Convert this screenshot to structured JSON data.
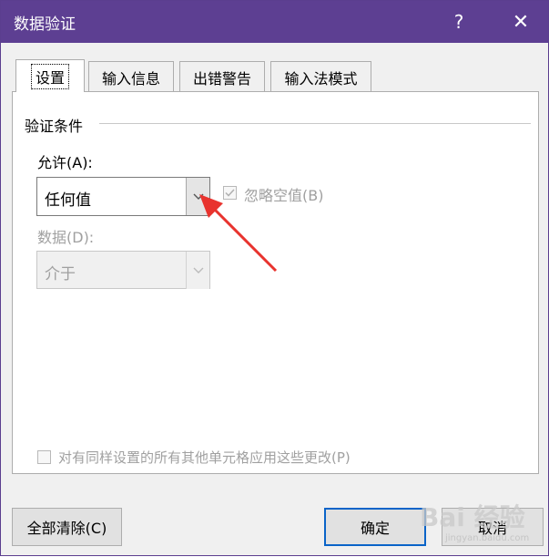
{
  "window": {
    "title": "数据验证",
    "help_glyph": "?",
    "close_glyph": "✕"
  },
  "tabs": [
    {
      "label": "设置",
      "active": true
    },
    {
      "label": "输入信息",
      "active": false
    },
    {
      "label": "出错警告",
      "active": false
    },
    {
      "label": "输入法模式",
      "active": false
    }
  ],
  "settings": {
    "group_label": "验证条件",
    "allow_label": "允许(A):",
    "allow_value": "任何值",
    "ignore_blank_label": "忽略空值(B)",
    "ignore_blank_checked": true,
    "data_label": "数据(D):",
    "data_value": "介于",
    "apply_all_label": "对有同样设置的所有其他单元格应用这些更改(P)",
    "apply_all_checked": false
  },
  "buttons": {
    "clear_all": "全部清除(C)",
    "ok": "确定",
    "cancel": "取消"
  },
  "watermark": {
    "text": "Bai 经验",
    "sub": "jingyan.baidu.com"
  },
  "colors": {
    "titlebar": "#5d3f92",
    "annotation_arrow": "#e8332e",
    "default_button_border": "#0a64c8"
  }
}
